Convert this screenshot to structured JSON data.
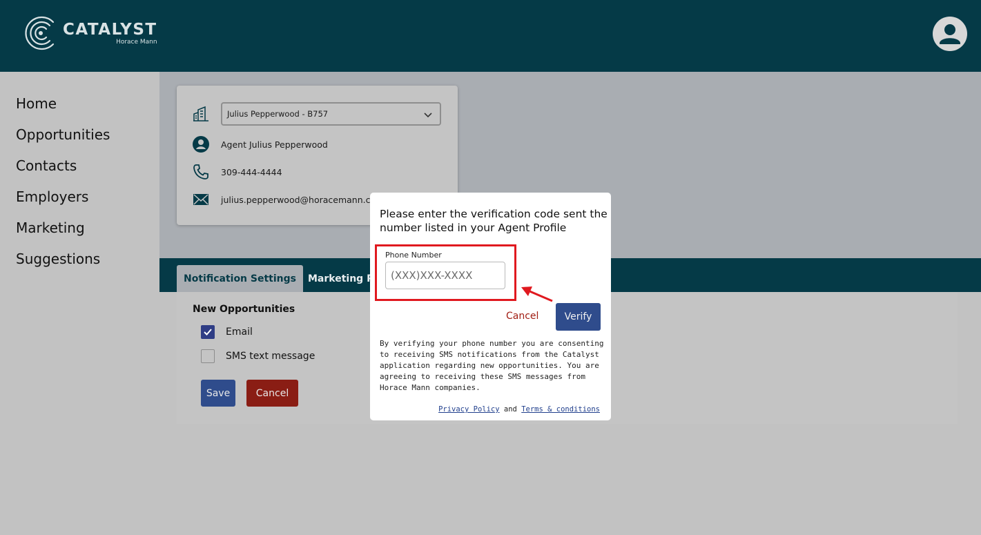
{
  "header": {
    "brand_title": "CATALYST",
    "brand_subtitle": "Horace Mann",
    "colors": {
      "header_bg": "#053a47",
      "primary_button": "#2f4c8c",
      "danger": "#8a1d14",
      "highlight": "#e0191f"
    },
    "icons": {
      "logo": "catalyst-logo-icon",
      "avatar": "user-avatar-icon"
    }
  },
  "sidebar": {
    "items": [
      {
        "label": "Home"
      },
      {
        "label": "Opportunities"
      },
      {
        "label": "Contacts"
      },
      {
        "label": "Employers"
      },
      {
        "label": "Marketing"
      },
      {
        "label": "Suggestions"
      }
    ]
  },
  "agent_card": {
    "selected_agency": "Julius Pepperwood - B757",
    "agent_name": "Agent Julius Pepperwood",
    "phone": "309-444-4444",
    "email": "julius.pepperwood@horacemann.co",
    "icons": {
      "agency": "building-icon",
      "name": "person-circle-icon",
      "phone": "phone-icon",
      "email": "mail-icon"
    }
  },
  "tabs": [
    {
      "label": "Notification Settings",
      "active": true
    },
    {
      "label": "Marketing P",
      "active": false
    }
  ],
  "settings": {
    "section_title": "New Opportunities",
    "options": [
      {
        "label": "Email",
        "checked": true
      },
      {
        "label": "SMS text message",
        "checked": false
      }
    ],
    "save_label": "Save",
    "cancel_label": "Cancel"
  },
  "modal": {
    "title": "Please enter the verification code sent the number listed in your Agent Profile",
    "field_label": "Phone Number",
    "field_placeholder": "(XXX)XXX-XXXX",
    "field_value": "",
    "cancel_label": "Cancel",
    "verify_label": "Verify",
    "consent_text": "By verifying your phone number you are consenting to receiving SMS notifications from the Catalyst application regarding new opportunities. You are agreeing to receiving these SMS messages from Horace Mann companies.",
    "privacy_link": "Privacy Policy",
    "and_text": "and",
    "terms_link": "Terms & conditions"
  }
}
